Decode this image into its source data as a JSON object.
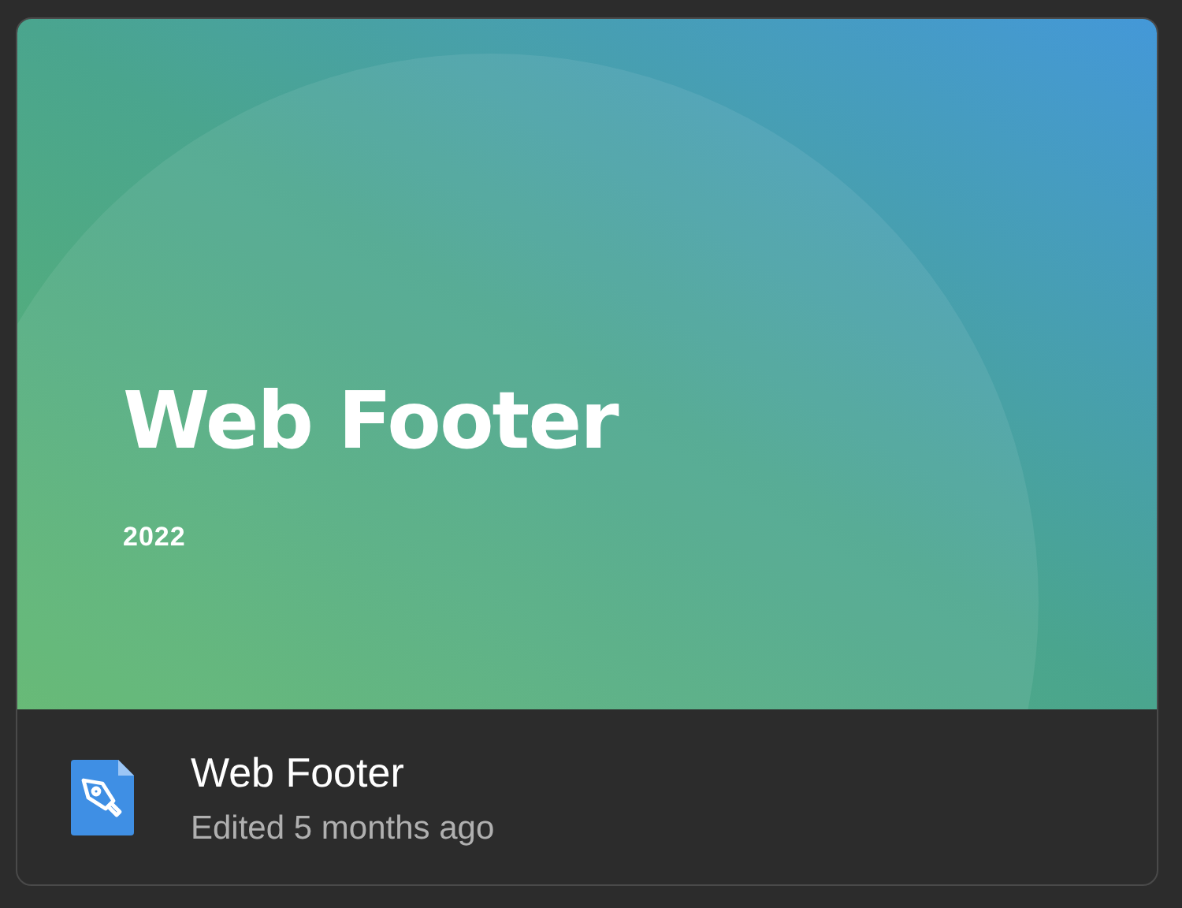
{
  "thumbnail": {
    "title": "Web Footer",
    "subtitle": "2022"
  },
  "file": {
    "name": "Web Footer",
    "edited": "Edited 5 months ago"
  }
}
